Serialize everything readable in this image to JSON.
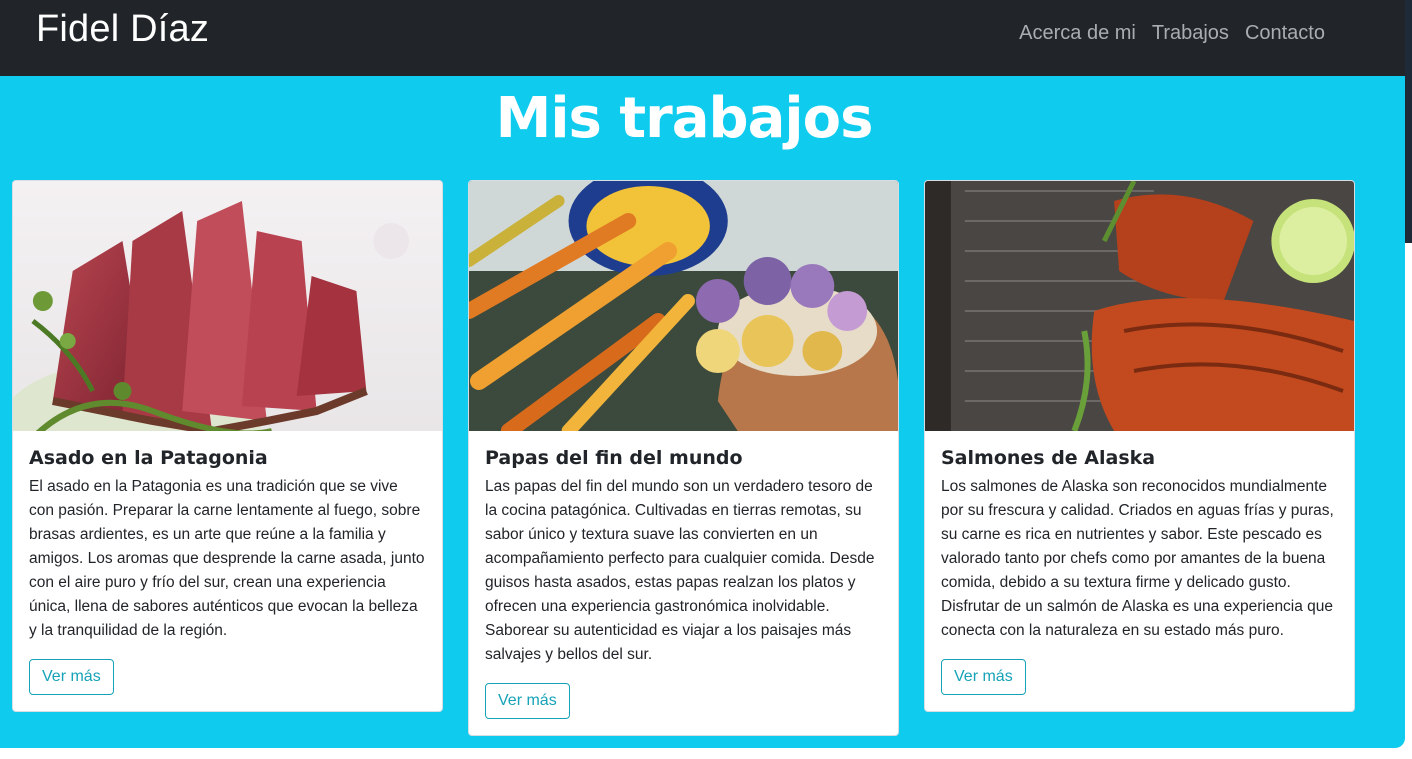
{
  "navbar": {
    "brand": "Fidel Díaz",
    "links": [
      "Acerca de mi",
      "Trabajos",
      "Contacto"
    ]
  },
  "page": {
    "title": "Mis trabajos"
  },
  "cards": [
    {
      "title": "Asado en la Patagonia",
      "text": "El asado en la Patagonia es una tradición que se vive con pasión. Preparar la carne lentamente al fuego, sobre brasas ardientes, es un arte que reúne a la familia y amigos. Los aromas que desprende la carne asada, junto con el aire puro y frío del sur, crean una experiencia única, llena de sabores auténticos que evocan la belleza y la tranquilidad de la región.",
      "button": "Ver más",
      "image": "seared-meat-photo"
    },
    {
      "title": "Papas del fin del mundo",
      "text": "Las papas del fin del mundo son un verdadero tesoro de la cocina patagónica. Cultivadas en tierras remotas, su sabor único y textura suave las convierten en un acompañamiento perfecto para cualquier comida. Desde guisos hasta asados, estas papas realzan los platos y ofrecen una experiencia gastronómica inolvidable. Saborear su autenticidad es viajar a los paisajes más salvajes y bellos del sur.",
      "button": "Ver más",
      "image": "potato-chips-carrots-photo"
    },
    {
      "title": "Salmones de Alaska",
      "text": "Los salmones de Alaska son reconocidos mundialmente por su frescura y calidad. Criados en aguas frías y puras, su carne es rica en nutrientes y sabor. Este pescado es valorado tanto por chefs como por amantes de la buena comida, debido a su textura firme y delicado gusto. Disfrutar de un salmón de Alaska es una experiencia que conecta con la naturaleza en su estado más puro.",
      "button": "Ver más",
      "image": "glazed-salmon-photo"
    }
  ],
  "colors": {
    "navbar": "#212529",
    "background": "#0fcbee",
    "accent": "#17a2b8"
  }
}
